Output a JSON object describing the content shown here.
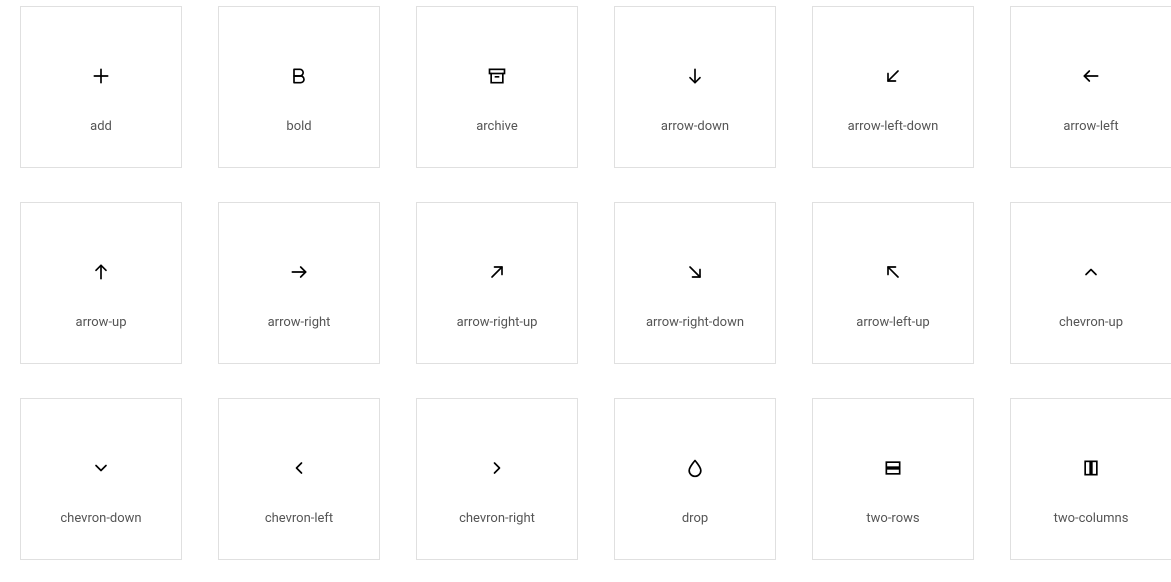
{
  "icons": [
    {
      "id": "add",
      "label": "add"
    },
    {
      "id": "bold",
      "label": "bold"
    },
    {
      "id": "archive",
      "label": "archive"
    },
    {
      "id": "arrow-down",
      "label": "arrow-down"
    },
    {
      "id": "arrow-left-down",
      "label": "arrow-left-down"
    },
    {
      "id": "arrow-left",
      "label": "arrow-left"
    },
    {
      "id": "arrow-up",
      "label": "arrow-up"
    },
    {
      "id": "arrow-right",
      "label": "arrow-right"
    },
    {
      "id": "arrow-right-up",
      "label": "arrow-right-up"
    },
    {
      "id": "arrow-right-down",
      "label": "arrow-right-down"
    },
    {
      "id": "arrow-left-up",
      "label": "arrow-left-up"
    },
    {
      "id": "chevron-up",
      "label": "chevron-up"
    },
    {
      "id": "chevron-down",
      "label": "chevron-down"
    },
    {
      "id": "chevron-left",
      "label": "chevron-left"
    },
    {
      "id": "chevron-right",
      "label": "chevron-right"
    },
    {
      "id": "drop",
      "label": "drop"
    },
    {
      "id": "two-rows",
      "label": "two-rows"
    },
    {
      "id": "two-columns",
      "label": "two-columns"
    }
  ]
}
